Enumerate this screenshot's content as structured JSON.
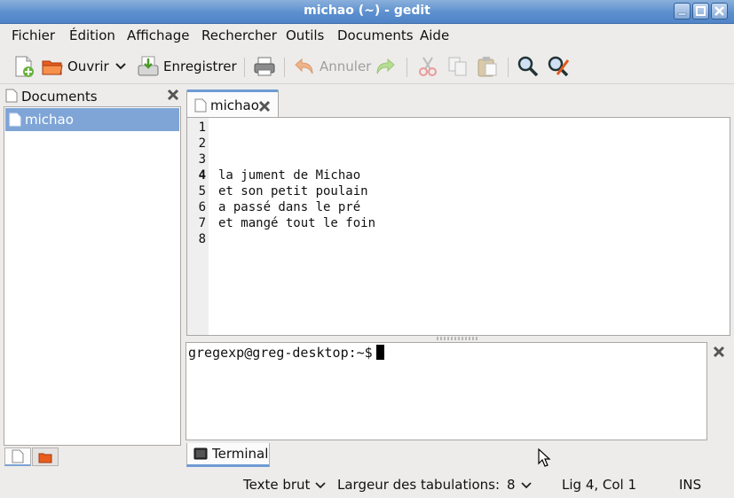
{
  "window": {
    "title": "michao (~) - gedit",
    "controls": [
      "minimize-icon",
      "maximize-icon",
      "close-icon"
    ]
  },
  "menubar": {
    "items": [
      "Fichier",
      "Édition",
      "Affichage",
      "Rechercher",
      "Outils",
      "Documents",
      "Aide"
    ]
  },
  "toolbar": {
    "open_label": "Ouvrir",
    "save_label": "Enregistrer",
    "undo_label": "Annuler",
    "icons": [
      "new-document-icon",
      "open-folder-icon",
      "dropdown-arrow-icon",
      "save-icon",
      "print-icon",
      "undo-icon",
      "redo-icon",
      "cut-icon",
      "copy-icon",
      "paste-icon",
      "search-icon",
      "search-replace-icon"
    ]
  },
  "side_panel": {
    "title": "Documents",
    "items": [
      {
        "label": "michao",
        "selected": true
      }
    ],
    "tabs": [
      "documents-tab-icon",
      "file-browser-tab-icon"
    ]
  },
  "document_tab": {
    "label": "michao"
  },
  "editor": {
    "line_numbers": [
      "1",
      "2",
      "3",
      "4",
      "5",
      "6",
      "7",
      "8"
    ],
    "current_line": 4,
    "lines": [
      "",
      "",
      "",
      "la jument de Michao",
      "et son petit poulain",
      "a passé dans le pré",
      "et mangé tout le foin",
      ""
    ]
  },
  "terminal": {
    "prompt": "gregexp@greg-desktop:~$"
  },
  "bottom_panel": {
    "tab_label": "Terminal"
  },
  "statusbar": {
    "language": "Texte brut",
    "tab_width_label": "Largeur des tabulations:",
    "tab_width_value": "8",
    "cursor_position": "Lig 4, Col 1",
    "insert_mode": "INS"
  },
  "colors": {
    "titlebar": "#5c8fce",
    "selection": "#7fa5d6",
    "tab_accent": "#6f9bd3",
    "window_bg": "#edeceb"
  }
}
